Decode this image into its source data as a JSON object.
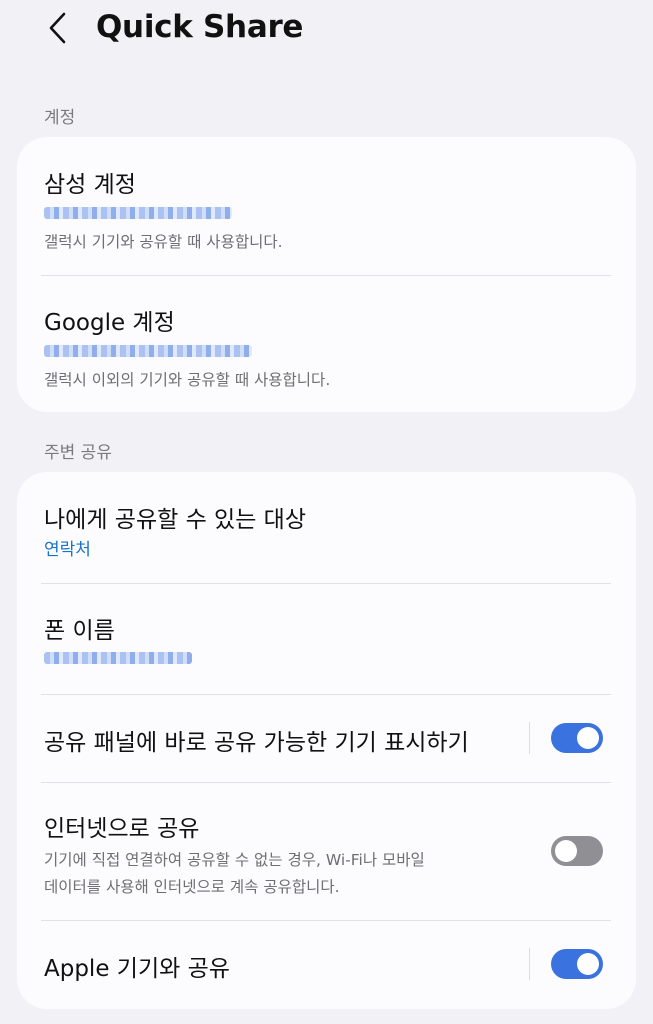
{
  "header": {
    "title": "Quick Share"
  },
  "sections": {
    "accounts": {
      "label": "계정",
      "samsung": {
        "title": "삼성 계정",
        "description": "갤럭시 기기와 공유할 때 사용합니다."
      },
      "google": {
        "title": "Google 계정",
        "description": "갤럭시 이외의 기기와 공유할 때 사용합니다."
      }
    },
    "nearby": {
      "label": "주변 공유",
      "who_can_share": {
        "title": "나에게 공유할 수 있는 대상",
        "value": "연락처"
      },
      "phone_name": {
        "title": "폰 이름"
      },
      "show_devices": {
        "title": "공유 패널에 바로 공유 가능한 기기 표시하기",
        "enabled": true
      },
      "internet_share": {
        "title": "인터넷으로 공유",
        "description_line1": "기기에 직접 연결하여 공유할 수 없는 경우, Wi-Fi나 모바일",
        "description_line2": "데이터를 사용해 인터넷으로 계속 공유합니다.",
        "enabled": false
      },
      "apple_share": {
        "title": "Apple 기기와 공유",
        "enabled": true
      }
    }
  },
  "colors": {
    "accent": "#3a73e0",
    "link": "#1a73c9",
    "background": "#f2f2f6",
    "card": "#fcfcff"
  }
}
